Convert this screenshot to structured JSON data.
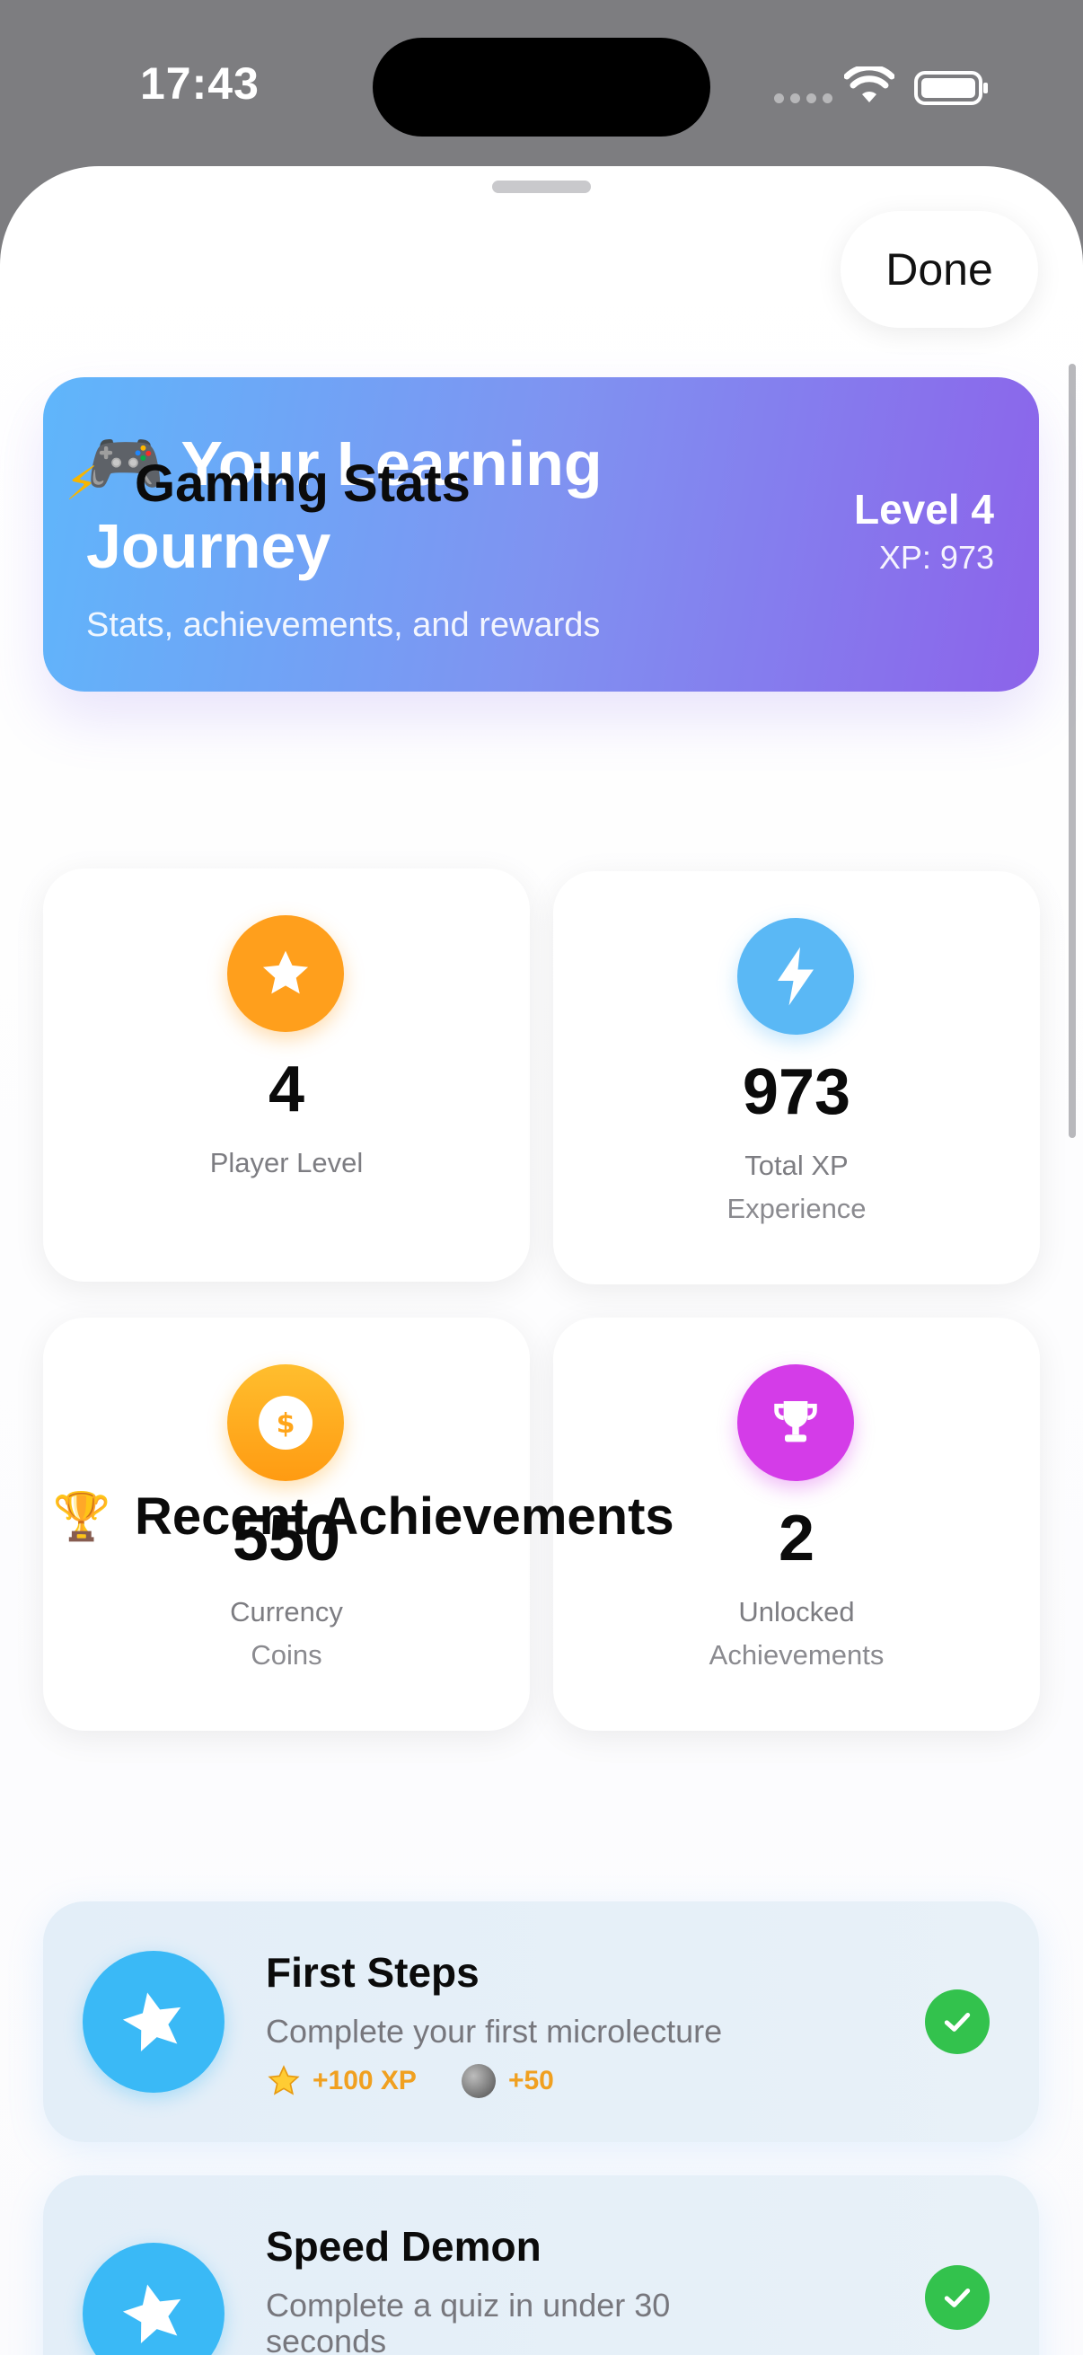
{
  "status_bar": {
    "time": "17:43"
  },
  "sheet": {
    "done_label": "Done"
  },
  "hero": {
    "emoji": "🎮",
    "title": "Your Learning Journey",
    "subtitle": "Stats, achievements, and rewards",
    "level": "Level 4",
    "xp": "XP: 973"
  },
  "gaming_stats": {
    "emoji": "⚡",
    "title": "Gaming Stats",
    "cards": [
      {
        "icon": "star-icon",
        "color": "#ff9f1c",
        "value": "4",
        "label": "Player Level",
        "sublabel": ""
      },
      {
        "icon": "bolt-icon",
        "color": "#5ab8f5",
        "value": "973",
        "label": "Total XP",
        "sublabel": "Experience"
      },
      {
        "icon": "dollar-coin-icon",
        "color": "#ffa51a",
        "value": "550",
        "label": "Currency",
        "sublabel": "Coins"
      },
      {
        "icon": "trophy-icon",
        "color": "#d43ce8",
        "value": "2",
        "label": "Unlocked",
        "sublabel": "Achievements"
      }
    ]
  },
  "achievements": {
    "emoji": "🏆",
    "title": "Recent Achievements",
    "items": [
      {
        "title": "First Steps",
        "description": "Complete your first microlecture",
        "xp_reward": "+100 XP",
        "coin_reward": "+50",
        "completed": true
      },
      {
        "title": "Speed Demon",
        "description": "Complete a quiz in under 30 seconds",
        "completed": true
      }
    ]
  },
  "colors": {
    "hero_start": "#5fb6fb",
    "hero_end": "#8c63ea",
    "check_green": "#33c24d",
    "achievement_blue": "#3ab9f6"
  }
}
